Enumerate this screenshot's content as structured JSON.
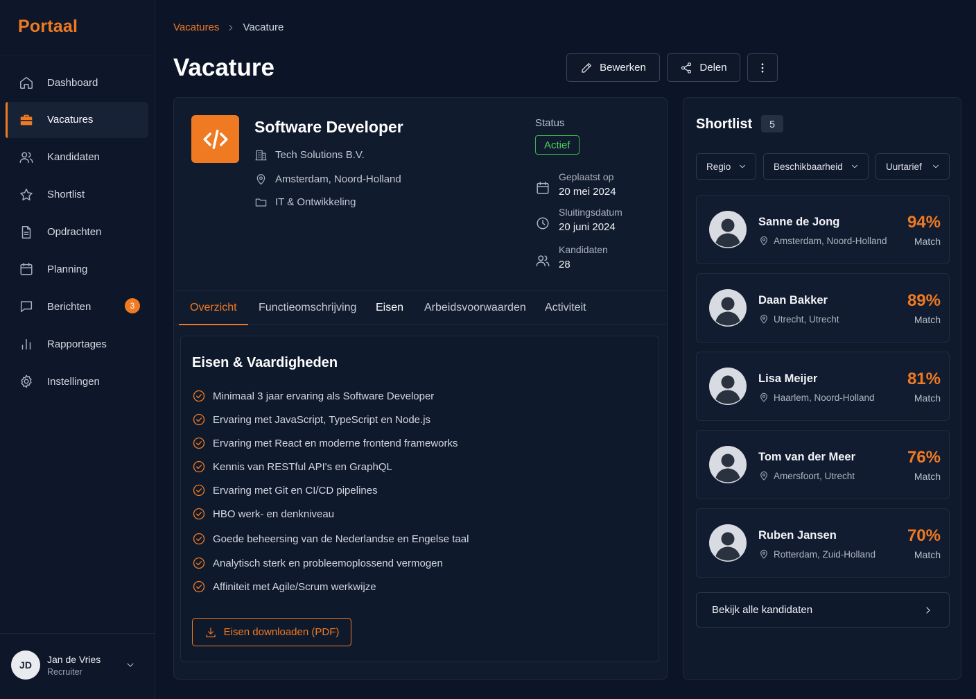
{
  "app": {
    "logo": "Portaal"
  },
  "sidebar": {
    "items": [
      {
        "label": "Dashboard",
        "icon": "home-icon"
      },
      {
        "label": "Vacatures",
        "icon": "briefcase-icon",
        "active": true
      },
      {
        "label": "Kandidaten",
        "icon": "users-icon"
      },
      {
        "label": "Shortlist",
        "icon": "star-icon"
      },
      {
        "label": "Opdrachten",
        "icon": "document-icon"
      },
      {
        "label": "Planning",
        "icon": "calendar-icon"
      },
      {
        "label": "Berichten",
        "icon": "message-icon",
        "badge": "3"
      },
      {
        "label": "Rapportages",
        "icon": "bar-chart-icon"
      },
      {
        "label": "Instellingen",
        "icon": "gear-icon"
      }
    ],
    "user": {
      "initials": "JD",
      "name": "Jan de Vries",
      "role": "Recruiter"
    }
  },
  "breadcrumb": {
    "parent": "Vacatures",
    "current": "Vacature"
  },
  "header": {
    "title": "Vacature",
    "edit_label": "Bewerken",
    "share_label": "Delen"
  },
  "job": {
    "title": "Software Developer",
    "company": "Tech Solutions B.V.",
    "location": "Amsterdam, Noord-Holland",
    "category": "IT & Ontwikkeling",
    "status_label": "Status",
    "status": "Actief",
    "posted_label": "Geplaatst op",
    "posted": "20 mei 2024",
    "closing_label": "Sluitingsdatum",
    "closing": "20 juni 2024",
    "candidates_label": "Kandidaten",
    "candidates": "28"
  },
  "tabs": [
    {
      "label": "Overzicht",
      "active": true
    },
    {
      "label": "Functieomschrijving"
    },
    {
      "label": "Eisen"
    },
    {
      "label": "Arbeidsvoorwaarden"
    },
    {
      "label": "Activiteit"
    }
  ],
  "requirements": {
    "title": "Eisen & Vaardigheden",
    "items": [
      "Minimaal 3 jaar ervaring als Software Developer",
      "Ervaring met JavaScript, TypeScript en Node.js",
      "Ervaring met React en moderne frontend frameworks",
      "Kennis van RESTful API's en GraphQL",
      "Ervaring met Git en CI/CD pipelines",
      "HBO werk- en denkniveau",
      "Goede beheersing van de Nederlandse en Engelse taal",
      "Analytisch sterk en probleemoplossend vermogen",
      "Affiniteit met Agile/Scrum werkwijze"
    ],
    "download_label": "Eisen downloaden (PDF)"
  },
  "shortlist": {
    "title": "Shortlist",
    "count": "5",
    "filters": [
      "Regio",
      "Beschikbaarheid",
      "Uurtarief"
    ],
    "candidates": [
      {
        "name": "Sanne de Jong",
        "location": "Amsterdam, Noord-Holland",
        "score": "94%",
        "match_label": "Match"
      },
      {
        "name": "Daan Bakker",
        "location": "Utrecht, Utrecht",
        "score": "89%",
        "match_label": "Match"
      },
      {
        "name": "Lisa Meijer",
        "location": "Haarlem, Noord-Holland",
        "score": "81%",
        "match_label": "Match"
      },
      {
        "name": "Tom van der Meer",
        "location": "Amersfoort, Utrecht",
        "score": "76%",
        "match_label": "Match"
      },
      {
        "name": "Ruben Jansen",
        "location": "Rotterdam, Zuid-Holland",
        "score": "70%",
        "match_label": "Match"
      }
    ],
    "view_all_label": "Bekijk alle kandidaten"
  },
  "colors": {
    "accent": "#f07a22",
    "background": "#0c1528",
    "status_active": "#4cd15b"
  }
}
